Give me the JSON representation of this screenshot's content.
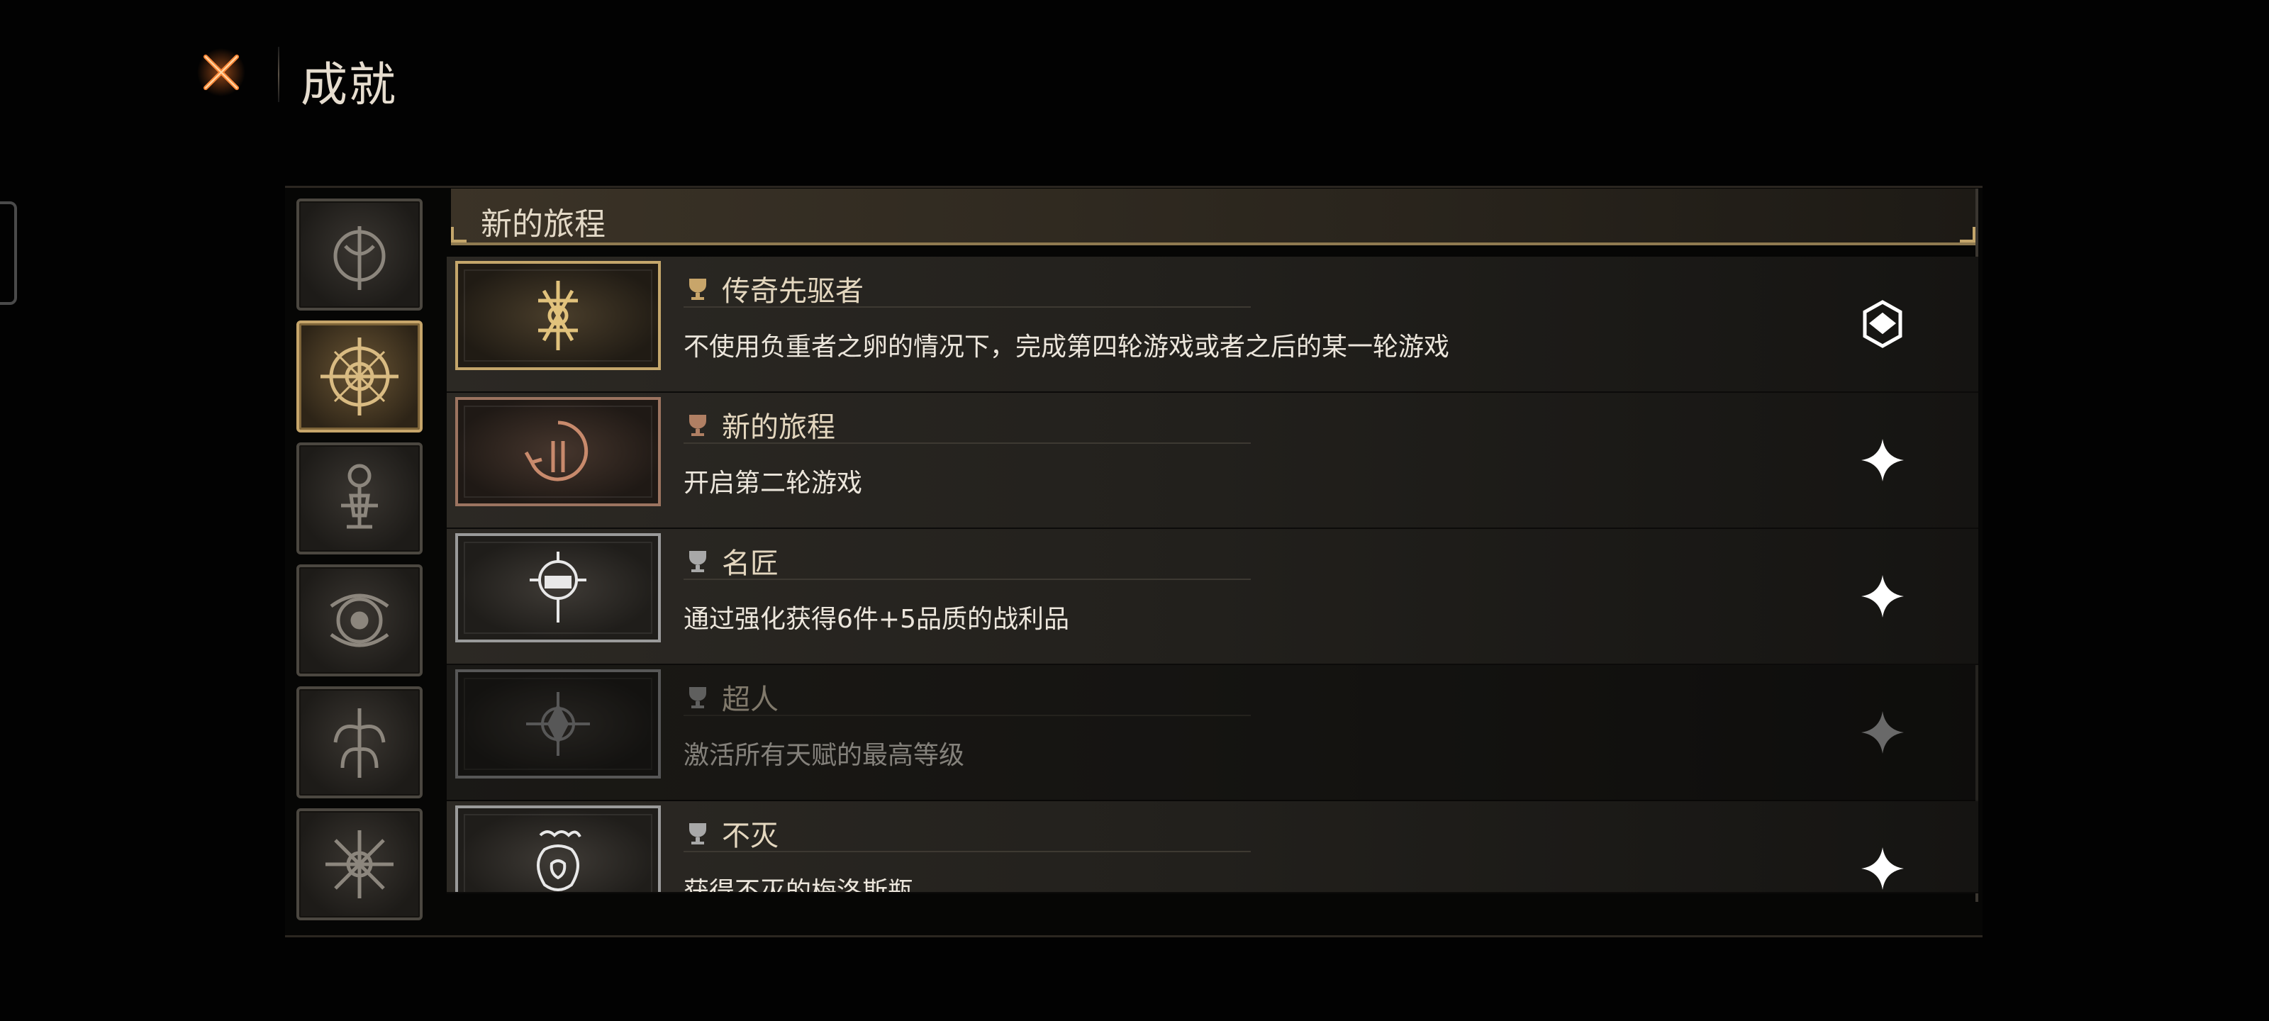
{
  "header": {
    "title": "成就",
    "close_icon": "crossed-swords-close-icon"
  },
  "colors": {
    "background": "#020202",
    "gold_accent": "#c4a66b",
    "text": "#e4d7bf"
  },
  "categories": [
    {
      "icon": "trident-emblem-icon",
      "active": false
    },
    {
      "icon": "compass-sigil-icon",
      "active": true
    },
    {
      "icon": "lantern-altar-icon",
      "active": false
    },
    {
      "icon": "eye-crest-icon",
      "active": false
    },
    {
      "icon": "tree-sigil-icon",
      "active": false
    },
    {
      "icon": "star-rune-icon",
      "active": false
    }
  ],
  "section": {
    "title": "新的旅程"
  },
  "achievements": [
    {
      "name": "传奇先驱者",
      "description": "不使用负重者之卵的情况下，完成第四轮游戏或者之后的某一轮游戏",
      "tier": "gold",
      "status_icon": "emblem-claimed-icon",
      "locked": false
    },
    {
      "name": "新的旅程",
      "description": "开启第二轮游戏",
      "tier": "copper",
      "status_icon": "sparkle-star-icon",
      "locked": false
    },
    {
      "name": "名匠",
      "description": "通过强化获得6件+5品质的战利品",
      "tier": "silver",
      "status_icon": "sparkle-star-icon",
      "locked": false
    },
    {
      "name": "超人",
      "description": "激活所有天赋的最高等级",
      "tier": "silver",
      "status_icon": "sparkle-star-icon",
      "locked": true
    },
    {
      "name": "不灭",
      "description": "获得不灭的梅洛斯瓶",
      "tier": "silver",
      "status_icon": "sparkle-star-icon",
      "locked": false
    }
  ]
}
